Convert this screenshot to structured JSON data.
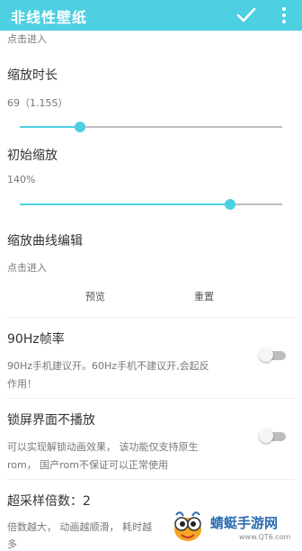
{
  "app_bar": {
    "title": "非线性壁纸",
    "confirm_icon": "check-icon",
    "menu_icon": "more-vert-icon"
  },
  "items": {
    "top_partial_subtitle": "点击进入",
    "zoom_duration": {
      "title": "缩放时长",
      "value": "69（1.15S）",
      "slider_fraction": 0.23
    },
    "initial_zoom": {
      "title": "初始缩放",
      "value": "140%",
      "slider_fraction": 0.8
    },
    "zoom_curve": {
      "title": "缩放曲线编辑",
      "subtitle": "点击进入",
      "preview_label": "预览",
      "reset_label": "重置"
    },
    "hz90": {
      "title": "90Hz帧率",
      "desc_line1": "90Hz手机建议开。60Hz手机不建议开,会起反",
      "desc_line2": "作用！",
      "enabled": false
    },
    "lock_screen": {
      "title": "锁屏界面不播放",
      "desc_line1": "可以实现解锁动画效果， 该功能仅支持原生",
      "desc_line2": "rom， 国产rom不保证可以正常使用",
      "enabled": false
    },
    "supersampling": {
      "title": "超采样倍数：2",
      "desc_line1": "倍数越大， 动画越顺滑， 耗时越",
      "desc_line2": "多"
    }
  },
  "watermark": {
    "name": "蜻蜓手游网",
    "url": "www.QT6.com"
  },
  "colors": {
    "accent": "#4dd0e1",
    "track": "#bdbdbd",
    "text_primary": "#333333",
    "text_secondary": "#777777"
  }
}
